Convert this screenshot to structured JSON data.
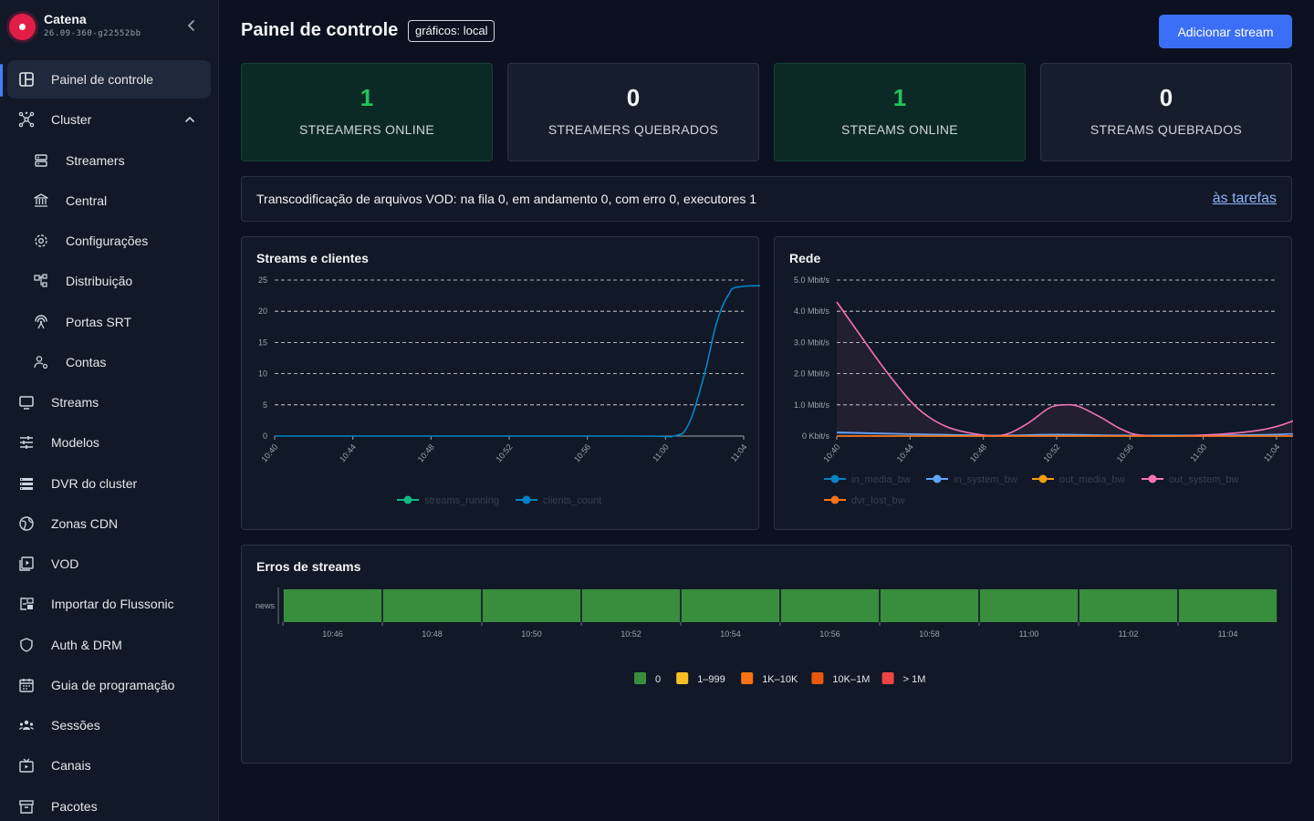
{
  "app": {
    "name": "Catena",
    "version": "26.09-360-g22552bb"
  },
  "sidebar": {
    "items": [
      {
        "label": "Painel de controle",
        "icon": "dashboard-icon"
      },
      {
        "label": "Cluster",
        "icon": "cluster-icon"
      },
      {
        "label": "Streamers",
        "icon": "server-icon"
      },
      {
        "label": "Central",
        "icon": "bank-icon"
      },
      {
        "label": "Configurações",
        "icon": "gear-icon"
      },
      {
        "label": "Distribuição",
        "icon": "distribution-icon"
      },
      {
        "label": "Portas SRT",
        "icon": "antenna-icon"
      },
      {
        "label": "Contas",
        "icon": "accounts-icon"
      },
      {
        "label": "Streams",
        "icon": "monitor-icon"
      },
      {
        "label": "Modelos",
        "icon": "sliders-icon"
      },
      {
        "label": "DVR do cluster",
        "icon": "list-icon"
      },
      {
        "label": "Zonas CDN",
        "icon": "globe-icon"
      },
      {
        "label": "VOD",
        "icon": "video-file-icon"
      },
      {
        "label": "Importar do Flussonic",
        "icon": "import-icon"
      },
      {
        "label": "Auth & DRM",
        "icon": "shield-icon"
      },
      {
        "label": "Guia de programação",
        "icon": "calendar-icon"
      },
      {
        "label": "Sessões",
        "icon": "users-icon"
      },
      {
        "label": "Canais",
        "icon": "tv-icon"
      },
      {
        "label": "Pacotes",
        "icon": "archive-icon"
      }
    ]
  },
  "header": {
    "title": "Painel de controle",
    "badge": "gráficos: local",
    "add_button": "Adicionar stream"
  },
  "stats": [
    {
      "value": "1",
      "label": "STREAMERS ONLINE",
      "status": "ok"
    },
    {
      "value": "0",
      "label": "STREAMERS QUEBRADOS",
      "status": "neutral"
    },
    {
      "value": "1",
      "label": "STREAMS ONLINE",
      "status": "ok"
    },
    {
      "value": "0",
      "label": "STREAMS QUEBRADOS",
      "status": "neutral"
    }
  ],
  "transcode": {
    "text": "Transcodificação de arquivos VOD: na fila 0, em andamento 0, com erro 0, executores 1",
    "link": "às tarefas"
  },
  "chart_data": [
    {
      "type": "line",
      "title": "Streams e clientes",
      "x": [
        "10:40",
        "10:44",
        "10:48",
        "10:52",
        "10:56",
        "11:00",
        "11:04"
      ],
      "ylim": [
        0,
        25
      ],
      "yticks": [
        "0",
        "5",
        "10",
        "15",
        "20",
        "25"
      ],
      "grid": true,
      "legend": "bottom",
      "series": [
        {
          "name": "streams_running",
          "color": "#10b981",
          "points": [
            [
              10.0,
              1
            ],
            [
              11.066,
              1
            ]
          ]
        },
        {
          "name": "clients_count",
          "color": "#0284c7",
          "points": [
            [
              0,
              0
            ],
            [
              4.5,
              0
            ],
            [
              5.1,
              0
            ],
            [
              5.3,
              2
            ],
            [
              5.5,
              10
            ],
            [
              5.65,
              18
            ],
            [
              5.8,
              22.5
            ],
            [
              6.0,
              24
            ],
            [
              7.0,
              24
            ]
          ]
        }
      ]
    },
    {
      "type": "area",
      "title": "Rede",
      "x": [
        "10:40",
        "10:44",
        "10:48",
        "10:52",
        "10:56",
        "11:00",
        "11:04"
      ],
      "ylim": [
        0,
        5
      ],
      "yticks": [
        "0 Kbit/s",
        "1.0 Mbit/s",
        "2.0 Mbit/s",
        "3.0 Mbit/s",
        "4.0 Mbit/s",
        "5.0 Mbit/s"
      ],
      "grid": true,
      "legend": "bottom",
      "series": [
        {
          "name": "in_media_bw",
          "color": "#0284c7",
          "points": [
            [
              0,
              0.1
            ],
            [
              2,
              0.02
            ],
            [
              3,
              0.02
            ],
            [
              4,
              0.02
            ],
            [
              6,
              0.05
            ],
            [
              7,
              0.2
            ]
          ]
        },
        {
          "name": "in_system_bw",
          "color": "#60a5fa",
          "points": [
            [
              0,
              0.12
            ],
            [
              2,
              0.02
            ],
            [
              3,
              0.05
            ],
            [
              4,
              0.02
            ],
            [
              6,
              0.05
            ],
            [
              7,
              0.22
            ]
          ]
        },
        {
          "name": "out_media_bw",
          "color": "#f59e0b",
          "points": [
            [
              0,
              0
            ],
            [
              7,
              0
            ]
          ]
        },
        {
          "name": "out_system_bw",
          "color": "#f472b6",
          "points": [
            [
              0,
              4.3
            ],
            [
              0.3,
              3.3
            ],
            [
              0.7,
              2.0
            ],
            [
              1.1,
              0.9
            ],
            [
              1.5,
              0.3
            ],
            [
              2,
              0.03
            ],
            [
              2.3,
              0.05
            ],
            [
              2.6,
              0.4
            ],
            [
              2.9,
              0.9
            ],
            [
              3.1,
              1.0
            ],
            [
              3.3,
              0.95
            ],
            [
              3.6,
              0.6
            ],
            [
              3.9,
              0.2
            ],
            [
              4.2,
              0.02
            ],
            [
              5,
              0.03
            ],
            [
              5.8,
              0.2
            ],
            [
              6.3,
              0.55
            ],
            [
              6.7,
              0.95
            ],
            [
              7,
              1.45
            ]
          ]
        },
        {
          "name": "dvr_lost_bw",
          "color": "#f97316",
          "points": [
            [
              0,
              0
            ],
            [
              7,
              0
            ]
          ]
        }
      ]
    },
    {
      "type": "heatmap",
      "title": "Erros de streams",
      "rows": [
        "news"
      ],
      "x": [
        "10:46",
        "10:48",
        "10:50",
        "10:52",
        "10:54",
        "10:56",
        "10:58",
        "11:00",
        "11:02",
        "11:04"
      ],
      "values": [
        [
          0,
          0,
          0,
          0,
          0,
          0,
          0,
          0,
          0,
          0
        ]
      ],
      "legend": [
        {
          "label": "0",
          "color": "#388e3c"
        },
        {
          "label": "1–999",
          "color": "#fbbf24"
        },
        {
          "label": "1K–10K",
          "color": "#f97316"
        },
        {
          "label": "10K–1M",
          "color": "#ea580c"
        },
        {
          "label": "> 1M",
          "color": "#ef4444"
        }
      ]
    }
  ]
}
